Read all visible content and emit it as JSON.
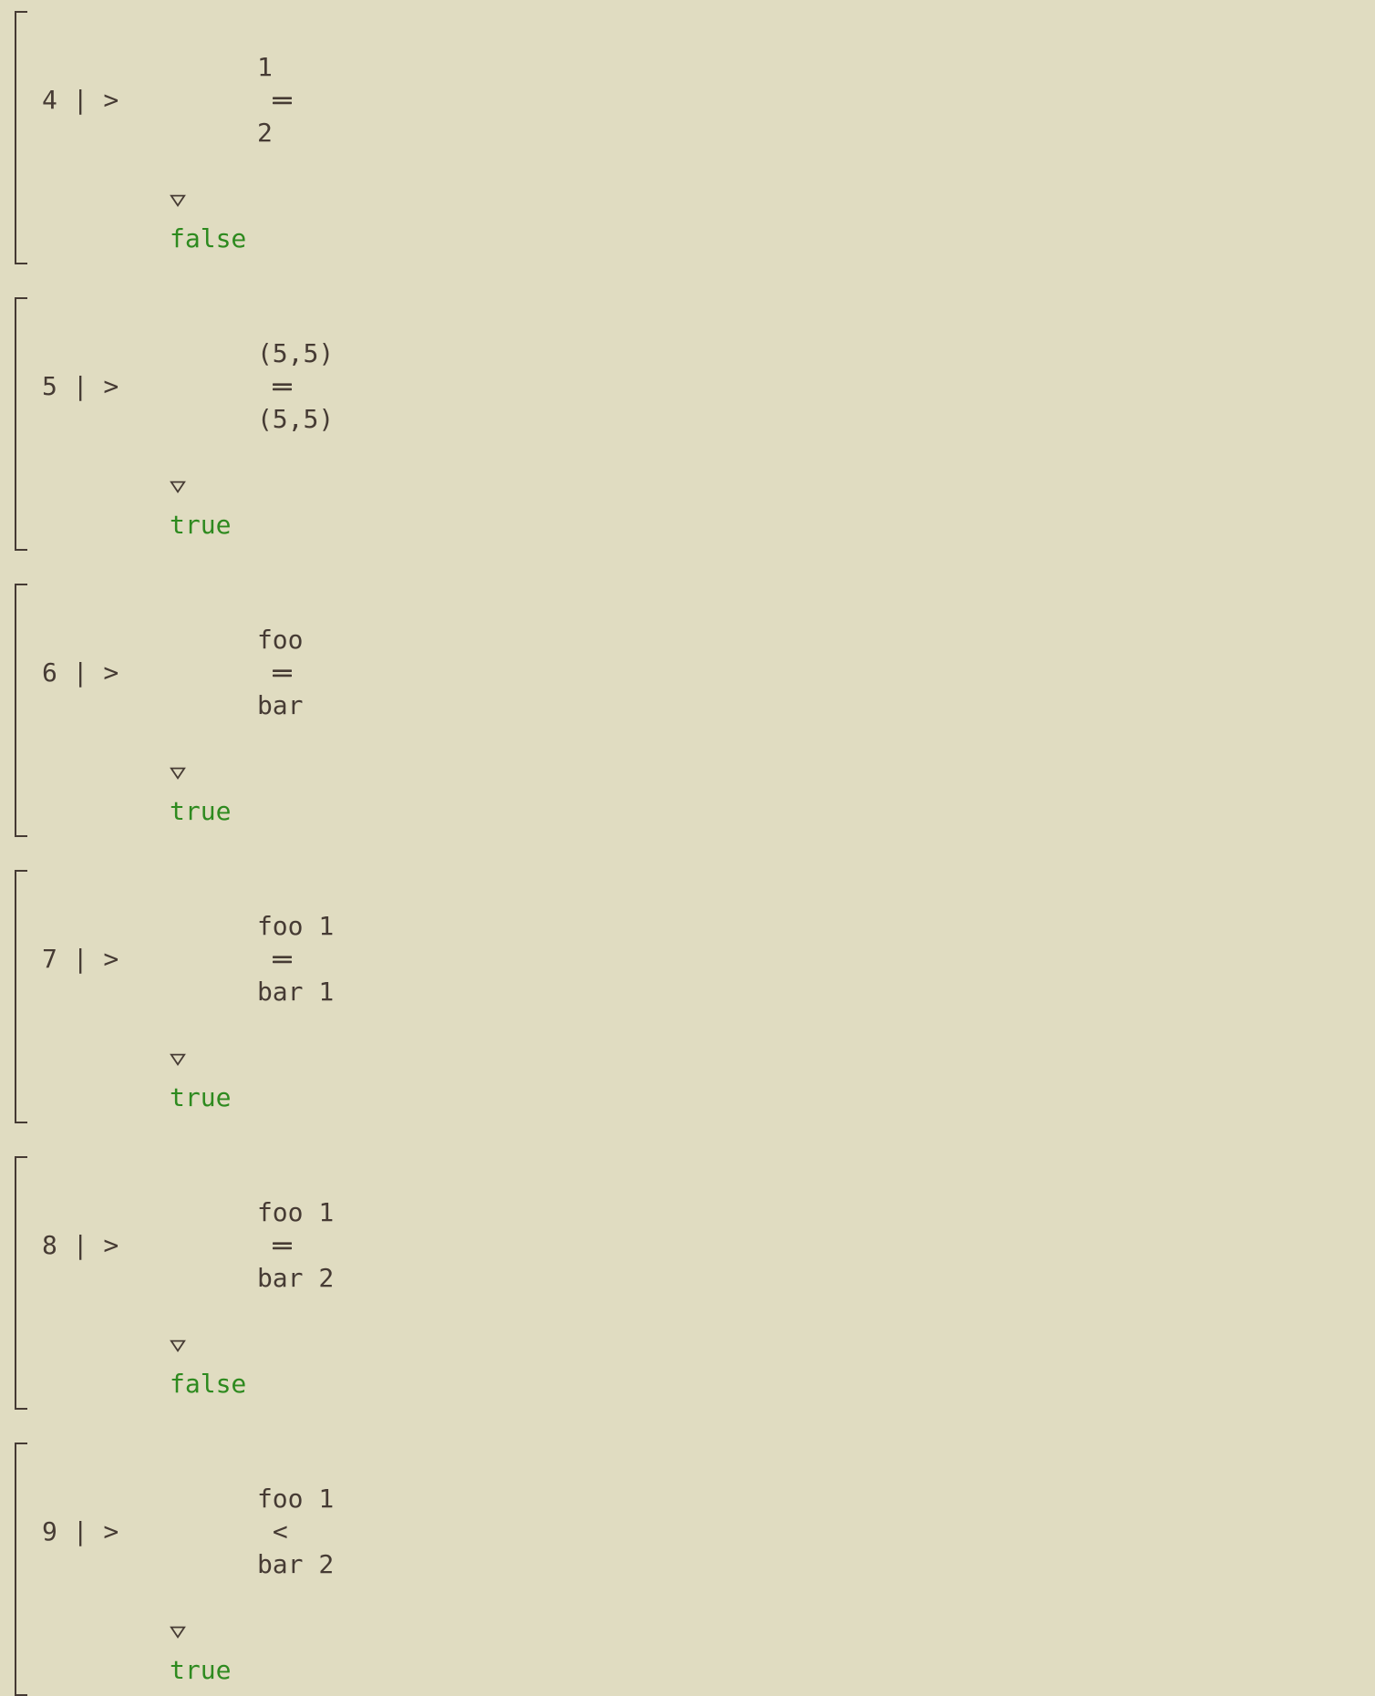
{
  "cells": [
    {
      "n": "4",
      "expr_lhs": "1",
      "op": "==",
      "expr_rhs": "2",
      "result": "false"
    },
    {
      "n": "5",
      "expr_lhs": "(5,5)",
      "op": "==",
      "expr_rhs": "(5,5)",
      "result": "true"
    },
    {
      "n": "6",
      "expr_lhs": "foo",
      "op": "==",
      "expr_rhs": "bar",
      "result": "true"
    },
    {
      "n": "7",
      "expr_lhs": "foo 1",
      "op": "==",
      "expr_rhs": "bar 1",
      "result": "true"
    },
    {
      "n": "8",
      "expr_lhs": "foo 1",
      "op": "==",
      "expr_rhs": "bar 2",
      "result": "false"
    },
    {
      "n": "9",
      "expr_lhs": "foo 1",
      "op": "<",
      "expr_rhs": "bar 2",
      "result": "true"
    }
  ],
  "prompt": ">",
  "column_sep": "|"
}
